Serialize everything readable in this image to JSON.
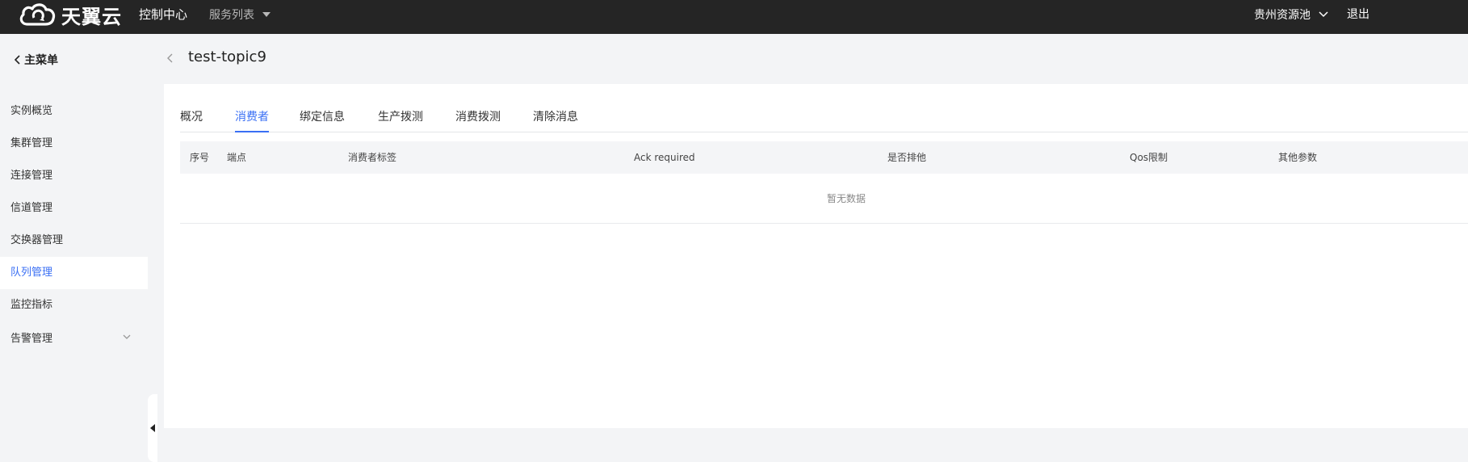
{
  "topbar": {
    "brand": "天翼云",
    "console": "控制中心",
    "service_list": "服务列表",
    "region": "贵州资源池",
    "logout": "退出"
  },
  "sidebar": {
    "back_label": "主菜单",
    "items": [
      {
        "label": "实例概览",
        "active": false
      },
      {
        "label": "集群管理",
        "active": false
      },
      {
        "label": "连接管理",
        "active": false
      },
      {
        "label": "信道管理",
        "active": false
      },
      {
        "label": "交换器管理",
        "active": false
      },
      {
        "label": "队列管理",
        "active": true
      },
      {
        "label": "监控指标",
        "active": false
      },
      {
        "label": "告警管理",
        "active": false,
        "expandable": true
      }
    ]
  },
  "page": {
    "title": "test-topic9"
  },
  "tabs": [
    {
      "label": "概况",
      "active": false
    },
    {
      "label": "消费者",
      "active": true
    },
    {
      "label": "绑定信息",
      "active": false
    },
    {
      "label": "生产拨测",
      "active": false
    },
    {
      "label": "消费拨测",
      "active": false
    },
    {
      "label": "清除消息",
      "active": false
    }
  ],
  "table": {
    "columns": [
      "序号",
      "端点",
      "消费者标签",
      "Ack required",
      "是否排他",
      "Qos限制",
      "其他参数"
    ],
    "empty_text": "暂无数据"
  },
  "colors": {
    "topbar_bg": "#252525",
    "accent": "#3a6ff4",
    "page_bg": "#f3f4f6"
  }
}
